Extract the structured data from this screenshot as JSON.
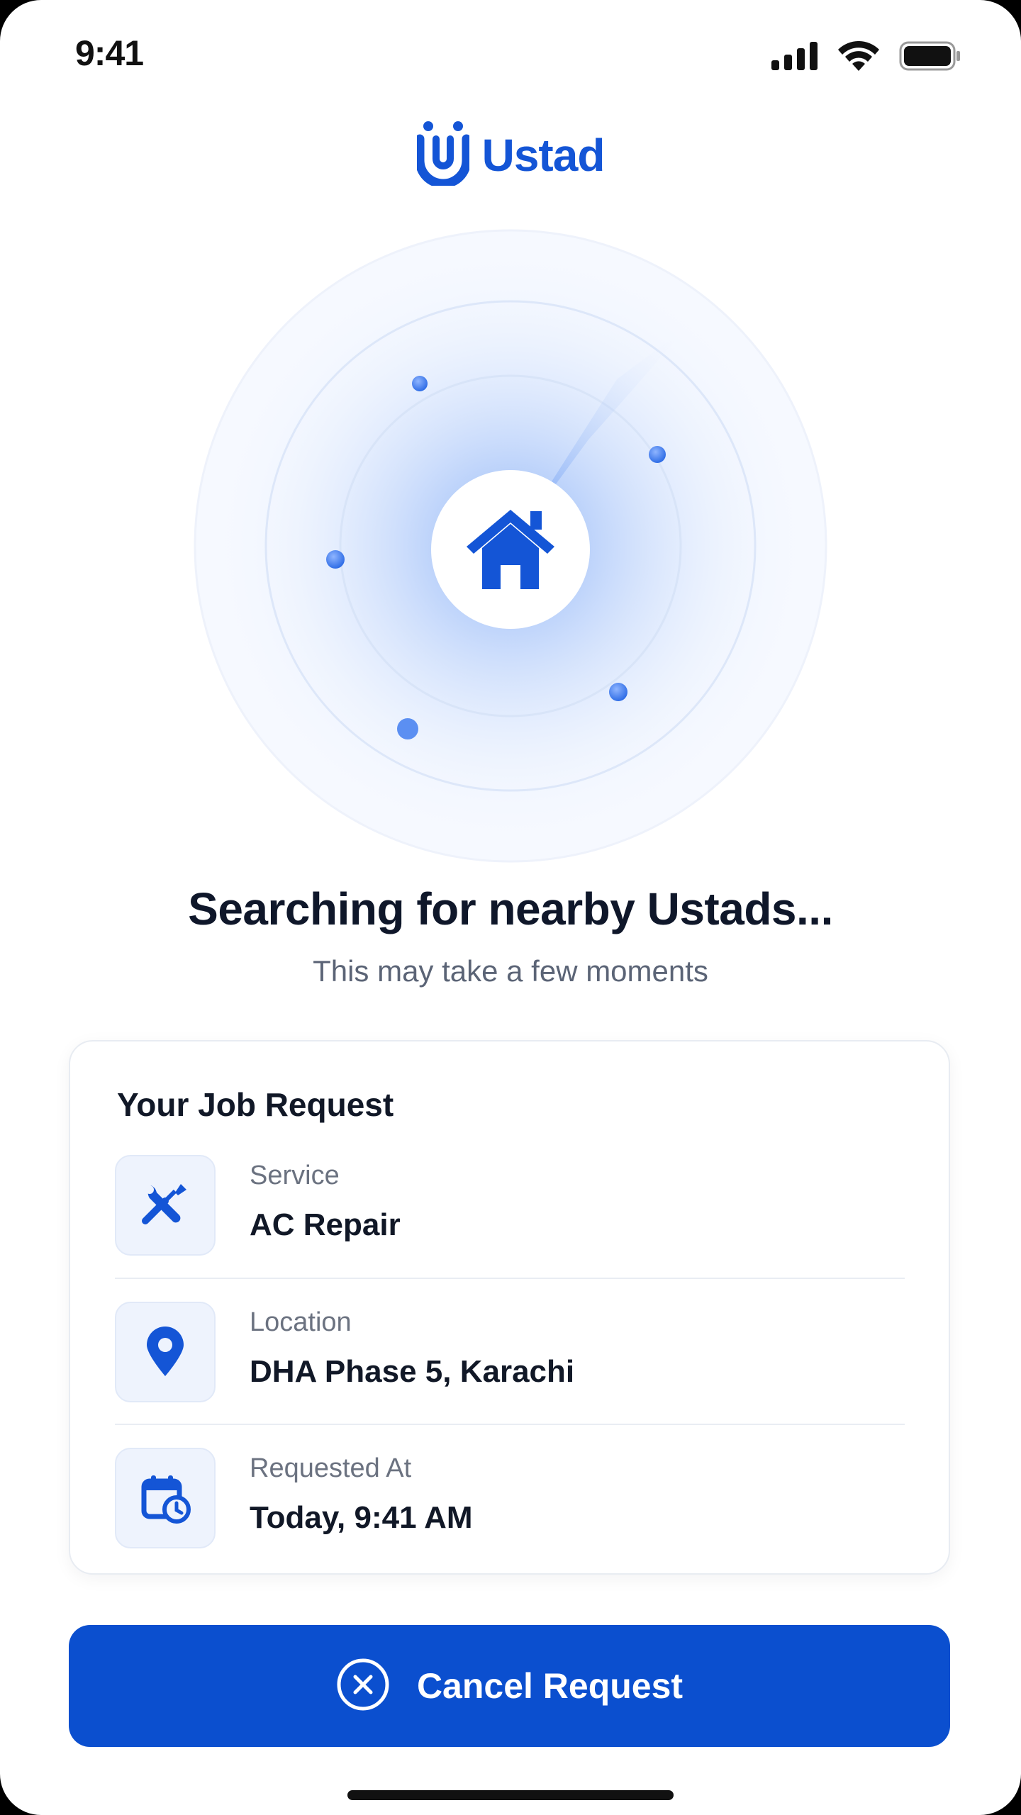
{
  "status_bar": {
    "time": "9:41"
  },
  "brand": {
    "name": "Ustad",
    "color": "#1455d6"
  },
  "search": {
    "headline": "Searching for nearby Ustads...",
    "subtext": "This may take a few moments"
  },
  "job_request": {
    "title": "Your Job Request",
    "rows": [
      {
        "icon": "tools-icon",
        "label": "Service",
        "value": "AC Repair"
      },
      {
        "icon": "location-pin-icon",
        "label": "Location",
        "value": "DHA Phase 5, Karachi"
      },
      {
        "icon": "calendar-clock-icon",
        "label": "Requested At",
        "value": "Today, 9:41 AM"
      }
    ]
  },
  "actions": {
    "cancel_label": "Cancel Request",
    "cancel_icon": "close-circle-icon"
  },
  "colors": {
    "accent": "#0b4fcf",
    "headline": "#0f172a",
    "muted": "#5b6476"
  }
}
